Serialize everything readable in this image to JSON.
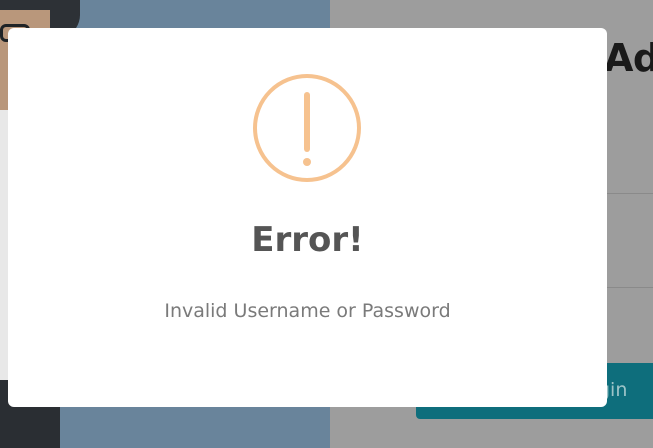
{
  "background": {
    "heading_partial": "Ad",
    "login_button_partial": "gin"
  },
  "modal": {
    "icon": "exclamation-circle-icon",
    "icon_color": "#f6c28f",
    "title": "Error!",
    "message": "Invalid Username or Password"
  }
}
